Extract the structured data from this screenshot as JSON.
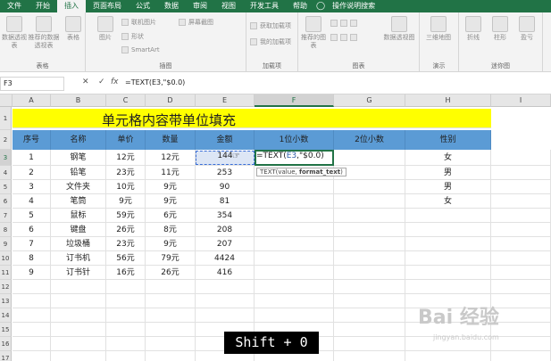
{
  "ribbon_tabs": [
    "文件",
    "开始",
    "插入",
    "页面布局",
    "公式",
    "数据",
    "审阅",
    "视图",
    "开发工具",
    "帮助",
    "操作说明搜索"
  ],
  "ribbon": {
    "groups": [
      "表格",
      "插图",
      "加载项",
      "图表",
      "演示",
      "迷你图"
    ],
    "buttons": {
      "pivot": "数据透视表",
      "recommended_pivot": "推荐的数据透视表",
      "table": "表格",
      "picture": "图片",
      "online_picture": "联机图片",
      "shapes": "形状",
      "smartart": "SmartArt",
      "screenshot": "屏幕截图",
      "get_addins": "获取加载项",
      "my_addins": "我的加载项",
      "recommended_charts": "推荐的图表",
      "pivot_chart": "数据透视图",
      "map3d": "三维地图",
      "spark_line": "折线",
      "spark_column": "柱形",
      "spark_winloss": "盈亏"
    }
  },
  "formula_bar": {
    "name_box": "F3",
    "cancel": "✕",
    "enter": "✓",
    "fx": "fx",
    "formula": "=TEXT(E3,\"$0.0)"
  },
  "sheet": {
    "columns": [
      "A",
      "B",
      "C",
      "D",
      "E",
      "F",
      "G",
      "H",
      "I"
    ],
    "row_numbers": [
      "1",
      "2",
      "3",
      "4",
      "5",
      "6",
      "7",
      "8",
      "9",
      "10",
      "11",
      "12",
      "13",
      "14",
      "15",
      "16",
      "17"
    ],
    "title": "单元格内容带单位填充",
    "headers": [
      "序号",
      "名称",
      "单价",
      "数量",
      "金额",
      "1位小数",
      "2位小数",
      "性别"
    ],
    "rows": [
      {
        "no": "1",
        "name": "钢笔",
        "price": "12元",
        "qty": "12元",
        "amount": "144",
        "gender": "女"
      },
      {
        "no": "2",
        "name": "铅笔",
        "price": "23元",
        "qty": "11元",
        "amount": "253",
        "gender": "男"
      },
      {
        "no": "3",
        "name": "文件夹",
        "price": "10元",
        "qty": "9元",
        "amount": "90",
        "gender": "男"
      },
      {
        "no": "4",
        "name": "笔筒",
        "price": "9元",
        "qty": "9元",
        "amount": "81",
        "gender": "女"
      },
      {
        "no": "5",
        "name": "鼠标",
        "price": "59元",
        "qty": "6元",
        "amount": "354",
        "gender": ""
      },
      {
        "no": "6",
        "name": "键盘",
        "price": "26元",
        "qty": "8元",
        "amount": "208",
        "gender": ""
      },
      {
        "no": "7",
        "name": "垃圾桶",
        "price": "23元",
        "qty": "9元",
        "amount": "207",
        "gender": ""
      },
      {
        "no": "8",
        "name": "订书机",
        "price": "56元",
        "qty": "79元",
        "amount": "4424",
        "gender": ""
      },
      {
        "no": "9",
        "name": "订书针",
        "price": "16元",
        "qty": "26元",
        "amount": "416",
        "gender": ""
      }
    ],
    "active_cell_prefix": "=TEXT(",
    "active_cell_ref": "E3",
    "active_cell_suffix": ",\"$0.0)",
    "tooltip_fn": "TEXT(value, ",
    "tooltip_arg": "format_text",
    "tooltip_end": ")"
  },
  "shortcut": "Shift + 0",
  "watermark": {
    "main": "Bai 经验",
    "sub": "jingyan.baidu.com"
  },
  "colors": {
    "accent": "#217346",
    "title_fill": "#ffff00",
    "header_fill": "#5b9bd5"
  }
}
